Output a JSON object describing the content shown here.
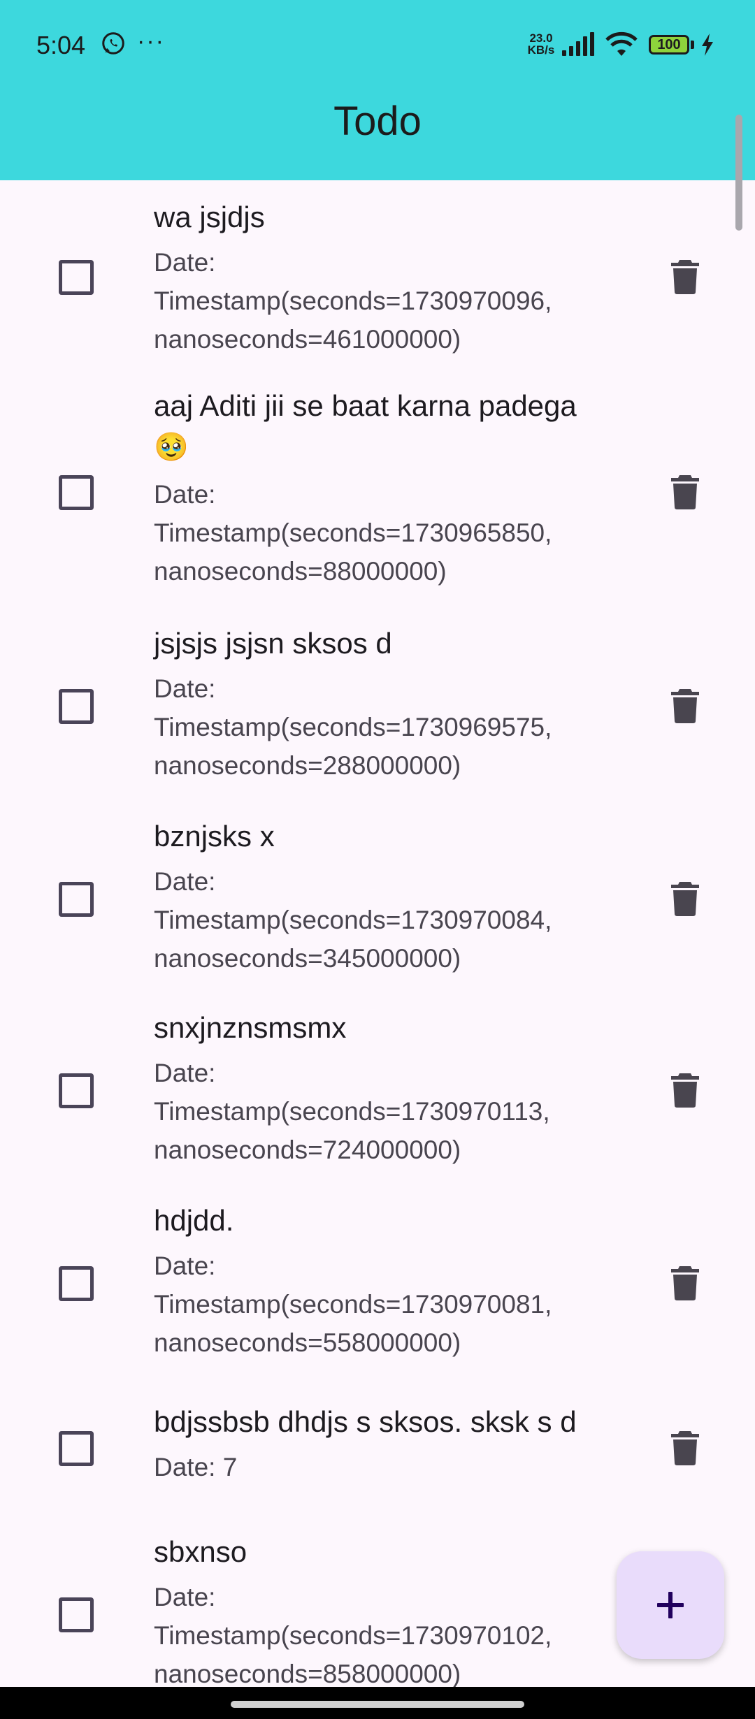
{
  "status_bar": {
    "time": "5:04",
    "more": "···",
    "net_speed_value": "23.0",
    "net_speed_unit": "KB/s",
    "battery": "100",
    "icons": [
      "whatsapp-icon",
      "signal-icon",
      "wifi-icon",
      "battery-icon",
      "charging-icon"
    ]
  },
  "app_bar": {
    "title": "Todo"
  },
  "todos": [
    {
      "title": "wa jsjdjs",
      "date_label": "Date:",
      "date_value": "Timestamp(seconds=1730970096,",
      "date_nanos": "nanoseconds=461000000)"
    },
    {
      "title": "aaj Aditi jii se baat karna padega",
      "title_emoji": "🥹",
      "date_label": "Date:",
      "date_value": "Timestamp(seconds=1730965850,",
      "date_nanos": "nanoseconds=88000000)"
    },
    {
      "title": "jsjsjs jsjsn sksos d",
      "date_label": "Date:",
      "date_value": "Timestamp(seconds=1730969575,",
      "date_nanos": "nanoseconds=288000000)"
    },
    {
      "title": "bznjsks x",
      "date_label": "Date:",
      "date_value": "Timestamp(seconds=1730970084,",
      "date_nanos": "nanoseconds=345000000)"
    },
    {
      "title": "snxjnznsmsmx",
      "date_label": "Date:",
      "date_value": "Timestamp(seconds=1730970113,",
      "date_nanos": "nanoseconds=724000000)"
    },
    {
      "title": "hdjdd.",
      "date_label": "Date:",
      "date_value": "Timestamp(seconds=1730970081,",
      "date_nanos": "nanoseconds=558000000)"
    },
    {
      "title": "bdjssbsb dhdjs s sksos. sksk s d",
      "date_short": "Date: 7"
    },
    {
      "title": "sbxnso",
      "date_label": "Date:",
      "date_value": "Timestamp(seconds=1730970102,",
      "date_nanos": "nanoseconds=858000000)"
    }
  ],
  "fab": {
    "icon": "plus-icon"
  },
  "colors": {
    "app_bar": "#3dd8dd",
    "background": "#fdf7fd",
    "fab": "#e9dcfb"
  }
}
